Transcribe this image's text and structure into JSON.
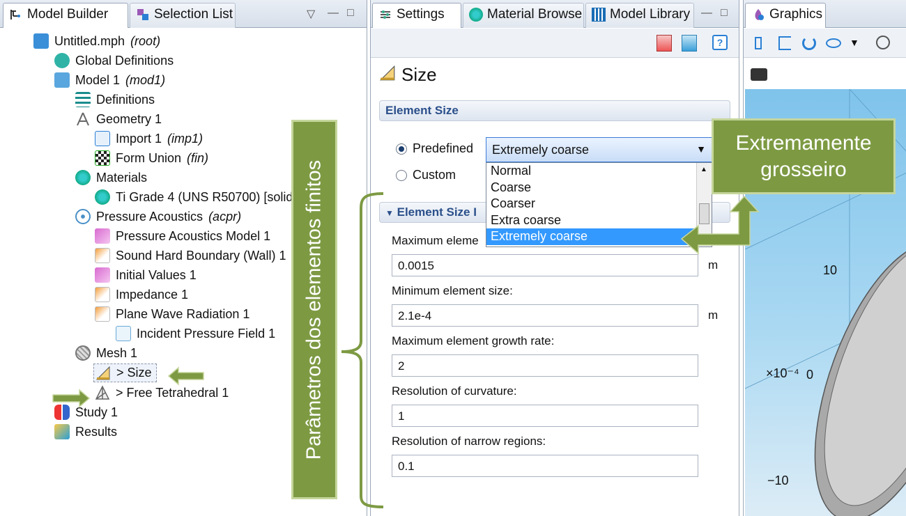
{
  "left_panel": {
    "tabs": [
      {
        "label": "Model Builder",
        "icon": "model-builder-icon"
      },
      {
        "label": "Selection List",
        "icon": "selection-list-icon"
      }
    ],
    "window_controls": [
      "▽",
      "—",
      "□"
    ],
    "tree": [
      {
        "label": "Untitled.mph",
        "suffix": "(root)",
        "icon": "root-file-icon"
      },
      {
        "label": "Global Definitions",
        "suffix": "",
        "icon": "global-definitions-icon"
      },
      {
        "label": "Model 1",
        "suffix": "(mod1)",
        "icon": "model-icon"
      },
      {
        "label": "Definitions",
        "suffix": "",
        "icon": "definitions-icon"
      },
      {
        "label": "Geometry 1",
        "suffix": "",
        "icon": "geometry-icon"
      },
      {
        "label": "Import 1",
        "suffix": "(imp1)",
        "icon": "import-icon"
      },
      {
        "label": "Form Union",
        "suffix": "(fin)",
        "icon": "form-union-icon"
      },
      {
        "label": "Materials",
        "suffix": "",
        "icon": "materials-icon"
      },
      {
        "label": "Ti Grade 4 (UNS R50700) [solid]",
        "suffix": "",
        "icon": "material-icon"
      },
      {
        "label": "Pressure Acoustics",
        "suffix": "(acpr)",
        "icon": "pressure-acoustics-icon"
      },
      {
        "label": "Pressure Acoustics Model 1",
        "suffix": "",
        "icon": "acoustics-model-icon"
      },
      {
        "label": "Sound Hard Boundary (Wall) 1",
        "suffix": "",
        "icon": "boundary-icon"
      },
      {
        "label": "Initial Values 1",
        "suffix": "",
        "icon": "initial-values-icon"
      },
      {
        "label": "Impedance 1",
        "suffix": "",
        "icon": "impedance-icon"
      },
      {
        "label": "Plane Wave Radiation 1",
        "suffix": "",
        "icon": "plane-wave-icon"
      },
      {
        "label": "Incident Pressure Field 1",
        "suffix": "",
        "icon": "incident-field-icon"
      },
      {
        "label": "Mesh 1",
        "suffix": "",
        "icon": "mesh-icon"
      },
      {
        "label": "> Size",
        "suffix": "",
        "icon": "size-icon"
      },
      {
        "label": "> Free Tetrahedral 1",
        "suffix": "",
        "icon": "tetrahedral-icon"
      },
      {
        "label": "Study 1",
        "suffix": "",
        "icon": "study-icon"
      },
      {
        "label": "Results",
        "suffix": "",
        "icon": "results-icon"
      }
    ]
  },
  "mid_panel": {
    "tabs": [
      {
        "label": "Settings",
        "icon": "settings-icon"
      },
      {
        "label": "Material Browse",
        "icon": "material-browser-icon"
      },
      {
        "label": "Model Library",
        "icon": "model-library-icon"
      }
    ],
    "title": "Size",
    "element_size": {
      "header": "Element Size",
      "predefined_label": "Predefined",
      "custom_label": "Custom",
      "selected": "Extremely coarse",
      "options": [
        "Normal",
        "Coarse",
        "Coarser",
        "Extra coarse",
        "Extremely coarse"
      ]
    },
    "parameters": {
      "header": "Element Size I",
      "fields": [
        {
          "label": "Maximum eleme",
          "value": "0.0015",
          "unit": "m"
        },
        {
          "label": "Minimum element size:",
          "value": "2.1e-4",
          "unit": "m"
        },
        {
          "label": "Maximum element growth rate:",
          "value": "2",
          "unit": ""
        },
        {
          "label": "Resolution of curvature:",
          "value": "1",
          "unit": ""
        },
        {
          "label": "Resolution of narrow regions:",
          "value": "0.1",
          "unit": ""
        }
      ]
    }
  },
  "right_panel": {
    "tab": {
      "label": "Graphics",
      "icon": "graphics-icon"
    },
    "axis_labels": {
      "ten": "10",
      "scale": "×10⁻⁴",
      "zero": "0",
      "minus_ten": "−10"
    }
  },
  "callouts": {
    "right_text": "Extremamente grosseiro",
    "vertical_text": "Parâmetros dos elementos finitos",
    "colors": {
      "fill": "#7d9a43",
      "border": "#c6d69c"
    }
  }
}
